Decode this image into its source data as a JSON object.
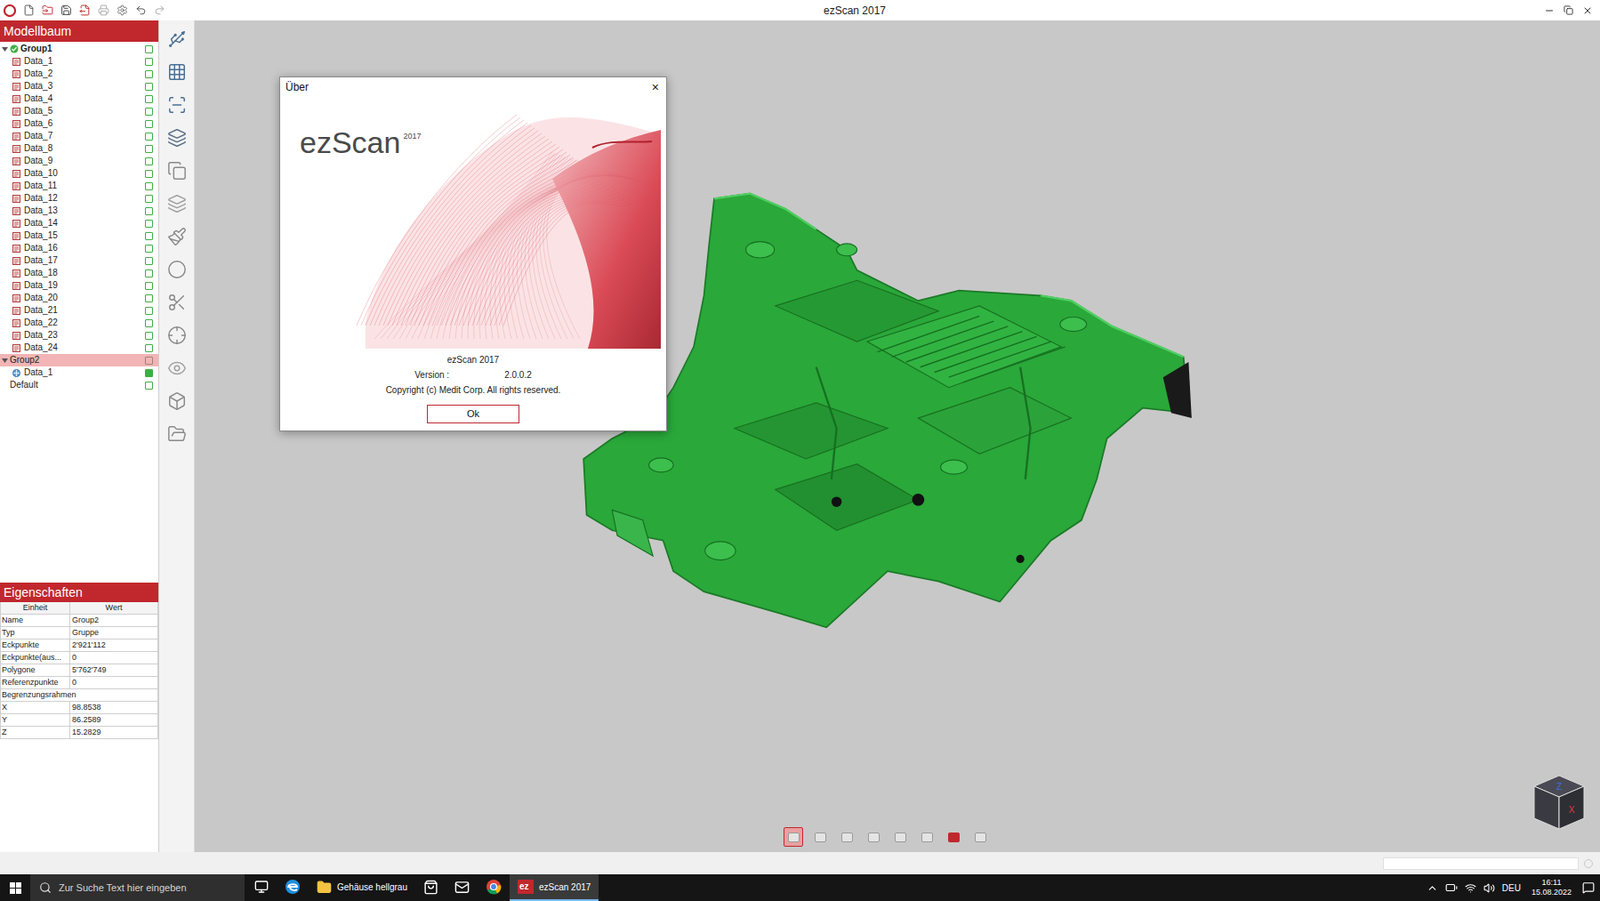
{
  "window": {
    "title": "ezScan 2017"
  },
  "model_tree": {
    "title": "Modellbaum",
    "groups": [
      {
        "name": "Group1",
        "expanded": true,
        "checked": true,
        "selected": false,
        "visible": true,
        "items": [
          {
            "name": "Data_1",
            "kind": "scan",
            "active": false
          },
          {
            "name": "Data_2",
            "kind": "scan",
            "active": false
          },
          {
            "name": "Data_3",
            "kind": "scan",
            "active": false
          },
          {
            "name": "Data_4",
            "kind": "scan",
            "active": false
          },
          {
            "name": "Data_5",
            "kind": "scan",
            "active": false
          },
          {
            "name": "Data_6",
            "kind": "scan",
            "active": false
          },
          {
            "name": "Data_7",
            "kind": "scan",
            "active": false
          },
          {
            "name": "Data_8",
            "kind": "scan",
            "active": false
          },
          {
            "name": "Data_9",
            "kind": "scan",
            "active": false
          },
          {
            "name": "Data_10",
            "kind": "scan",
            "active": false
          },
          {
            "name": "Data_11",
            "kind": "scan",
            "active": false
          },
          {
            "name": "Data_12",
            "kind": "scan",
            "active": false
          },
          {
            "name": "Data_13",
            "kind": "scan",
            "active": false
          },
          {
            "name": "Data_14",
            "kind": "scan",
            "active": false
          },
          {
            "name": "Data_15",
            "kind": "scan",
            "active": false
          },
          {
            "name": "Data_16",
            "kind": "scan",
            "active": false
          },
          {
            "name": "Data_17",
            "kind": "scan",
            "active": false
          },
          {
            "name": "Data_18",
            "kind": "scan",
            "active": false
          },
          {
            "name": "Data_19",
            "kind": "scan",
            "active": false
          },
          {
            "name": "Data_20",
            "kind": "scan",
            "active": false
          },
          {
            "name": "Data_21",
            "kind": "scan",
            "active": false
          },
          {
            "name": "Data_22",
            "kind": "scan",
            "active": false
          },
          {
            "name": "Data_23",
            "kind": "scan",
            "active": false
          },
          {
            "name": "Data_24",
            "kind": "scan",
            "active": false
          }
        ]
      },
      {
        "name": "Group2",
        "expanded": true,
        "checked": false,
        "selected": true,
        "visible": false,
        "items": [
          {
            "name": "Data_1",
            "kind": "mesh",
            "active": true
          }
        ]
      },
      {
        "name": "Default",
        "expanded": false,
        "checked": false,
        "selected": false,
        "visible": true,
        "items": []
      }
    ]
  },
  "properties": {
    "title": "Eigenschaften",
    "columns": [
      "Einheit",
      "Wert"
    ],
    "rows": [
      {
        "kind": "field",
        "unit": "Name",
        "value": "Group2"
      },
      {
        "kind": "field",
        "unit": "Typ",
        "value": "Gruppe"
      },
      {
        "kind": "field",
        "unit": "Eckpunkte",
        "value": "2'921'112"
      },
      {
        "kind": "field",
        "unit": "Eckpunkte(aus...",
        "value": "0"
      },
      {
        "kind": "field",
        "unit": "Polygone",
        "value": "5'762'749"
      },
      {
        "kind": "field",
        "unit": "Referenzpunkte",
        "value": "0"
      },
      {
        "kind": "section",
        "unit": "Begrenzungsrahmen",
        "value": ""
      },
      {
        "kind": "field",
        "unit": "X",
        "value": "98.8538"
      },
      {
        "kind": "field",
        "unit": "Y",
        "value": "86.2589"
      },
      {
        "kind": "field",
        "unit": "Z",
        "value": "15.2829"
      }
    ]
  },
  "dialog": {
    "title": "Über",
    "close": "×",
    "logo": "ezScan",
    "logo_year": "2017",
    "product": "ezScan 2017",
    "version_label": "Version :",
    "version": "2.0.0.2",
    "copyright": "Copyright (c) Medit Corp. All rights reserved.",
    "button": "Ok"
  },
  "view_toolbar": [
    {
      "selected": true
    },
    {
      "selected": false
    },
    {
      "selected": false
    },
    {
      "selected": false
    },
    {
      "selected": false
    },
    {
      "selected": false
    },
    {
      "selected": false
    },
    {
      "selected": false
    }
  ],
  "view_cube": {
    "top": "Z",
    "front": "X"
  },
  "taskbar": {
    "search_placeholder": "Zur Suche Text hier eingeben",
    "apps": [
      {
        "kind": "taskview",
        "active": false
      },
      {
        "kind": "edge",
        "active": false
      },
      {
        "kind": "explorer",
        "label": "Gehäuse hellgrau",
        "active": false
      },
      {
        "kind": "store",
        "active": false
      },
      {
        "kind": "mail",
        "active": false
      },
      {
        "kind": "chrome",
        "active": false
      },
      {
        "kind": "ezscan",
        "icon_text": "ez",
        "label": "ezScan 2017",
        "active": true
      }
    ],
    "language": "DEU",
    "time": "16:11",
    "date": "15.08.2022"
  }
}
